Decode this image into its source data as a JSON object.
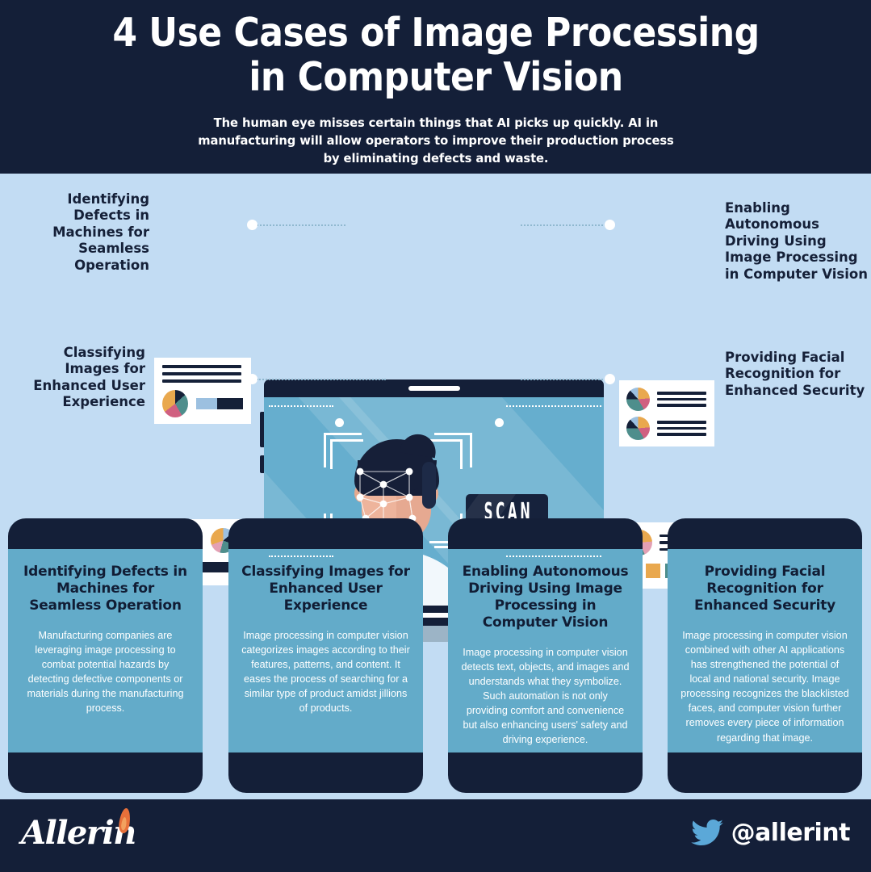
{
  "colors": {
    "background": "#c2dcf3",
    "navy": "#141f38",
    "screen_blue": "#66aece",
    "card_blue": "#63abc9",
    "pie_orange": "#e9a84e",
    "pie_teal": "#4e8e8c",
    "pie_pink": "#d06080",
    "pie_lightblue": "#9cc0e0",
    "pie_navy": "#152038",
    "flame_orange": "#e8703a",
    "twitter_blue": "#5ba8d8",
    "white": "#ffffff"
  },
  "header": {
    "title_line1": "4 Use Cases of Image Processing",
    "title_line2": "in Computer Vision",
    "subtitle": "The human eye misses certain things that AI picks up quickly. AI in manufacturing will allow operators to improve their production process by eliminating defects and waste."
  },
  "hero": {
    "scan_label": "SCAN",
    "side_labels": [
      {
        "id": "identifying-defects",
        "text": "Identifying Defects in Machines for Seamless Operation",
        "side": "left"
      },
      {
        "id": "classifying-images",
        "text": "Classifying Images for Enhanced User Experience",
        "side": "left"
      },
      {
        "id": "autonomous-driving",
        "text": "Enabling Autonomous Driving Using Image Processing in Computer Vision",
        "side": "right"
      },
      {
        "id": "facial-recognition",
        "text": "Providing Facial Recognition for Enhanced Security",
        "side": "right"
      }
    ],
    "icon_cards": [
      {
        "id": "icon-card-lines-pie-bar",
        "elements": "3 lines, pie chart, progress bar"
      },
      {
        "id": "icon-card-two-pies-bar",
        "elements": "2 pie charts, progress bar"
      },
      {
        "id": "icon-card-two-pies-lines",
        "elements": "2 pie charts with text lines"
      },
      {
        "id": "icon-card-pie-lines-swatches",
        "elements": "pie chart, lines, 4 color swatches"
      }
    ]
  },
  "cards": [
    {
      "title": "Identifying Defects in Machines for Seamless Operation",
      "body": "Manufacturing companies are leveraging image processing to combat potential hazards by detecting defective components or materials during the manufacturing process."
    },
    {
      "title": "Classifying Images for Enhanced User Experience",
      "body": "Image processing in computer vision categorizes images according to their features, patterns, and content. It eases the process of searching for a similar type of product amidst jillions of products."
    },
    {
      "title": "Enabling Autonomous Driving Using Image Processing in Computer Vision",
      "body": "Image processing in computer vision detects text, objects, and images and understands what they symbolize. Such automation is not only providing comfort and convenience but also enhancing users' safety and driving experience."
    },
    {
      "title": "Providing Facial Recognition for Enhanced Security",
      "body": "Image processing in computer vision combined with other AI applications has strengthened the potential of local and national security. Image processing recognizes the blacklisted faces, and computer vision further removes every piece of information regarding that image."
    }
  ],
  "footer": {
    "brand": "Allerin",
    "twitter_handle": "@allerint"
  }
}
